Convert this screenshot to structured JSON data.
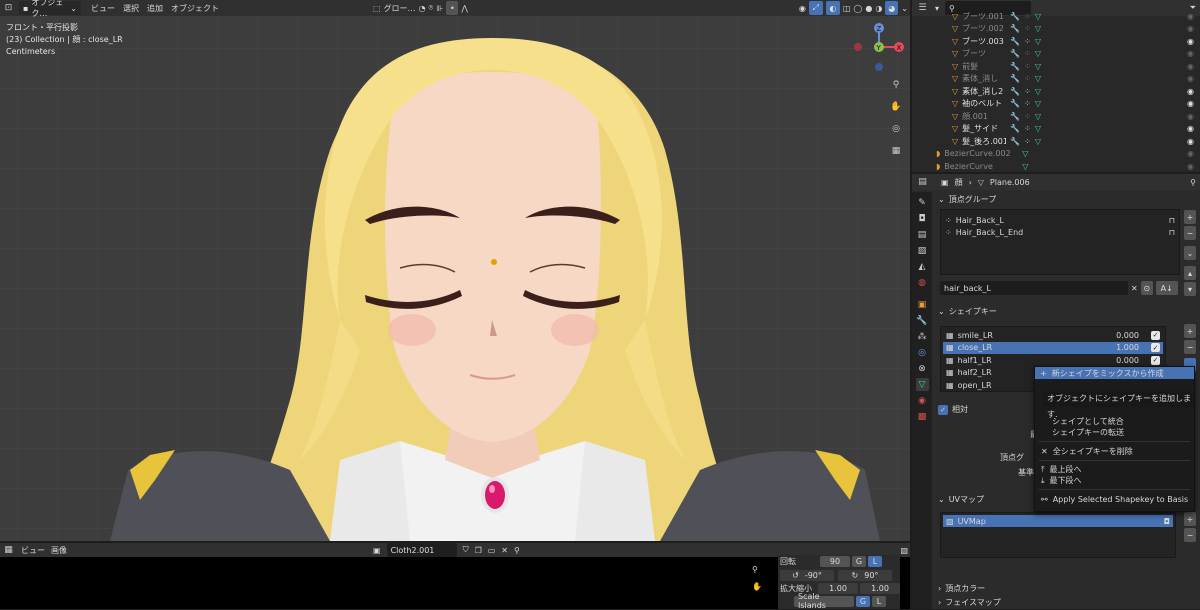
{
  "viewport": {
    "menu": [
      "ビュー",
      "選択",
      "追加",
      "オブジェクト"
    ],
    "mode": "オブジェク…",
    "transform": "グロー…",
    "overlay_line1": "フロント・平行投影",
    "overlay_line2": "(23) Collection | 顔 : close_LR",
    "overlay_line3": "Centimeters"
  },
  "uv_editor": {
    "menu": [
      "ビュー",
      "画像"
    ],
    "image_name": "Cloth2.001",
    "rot_label": "回転",
    "rot_buttons": [
      "90",
      "G",
      "L"
    ],
    "rot_values": [
      "-90°",
      "90°"
    ],
    "scale_label": "拡大縮小",
    "scale_values": [
      "1.00",
      "1.00"
    ],
    "scale_islands": "Scale Islands",
    "scale_islands_btns": [
      "G",
      "L"
    ]
  },
  "outliner": {
    "items": [
      {
        "name": "ブーツ.001",
        "bold": false
      },
      {
        "name": "ブーツ.002",
        "bold": false
      },
      {
        "name": "ブーツ.003",
        "bold": true
      },
      {
        "name": "ブーツ",
        "bold": false
      },
      {
        "name": "前髪",
        "bold": false
      },
      {
        "name": "素体_消し",
        "bold": false
      },
      {
        "name": "素体_消し2",
        "bold": true
      },
      {
        "name": "袖のベルト",
        "bold": true
      },
      {
        "name": "顔.001",
        "bold": false
      },
      {
        "name": "髪_サイド",
        "bold": true
      },
      {
        "name": "髪_後ろ.001",
        "bold": true
      },
      {
        "name": "BezierCurve.002",
        "bold": false
      },
      {
        "name": "BezierCurve",
        "bold": false
      }
    ]
  },
  "properties": {
    "breadcrumb_object": "顔",
    "breadcrumb_mesh": "Plane.006",
    "vertex_groups": {
      "title": "頂点グループ",
      "items": [
        "Hair_Back_L",
        "Hair_Back_L_End"
      ],
      "filter_value": "hair_back_L"
    },
    "shape_keys": {
      "title": "シェイプキー",
      "items": [
        {
          "name": "smile_LR",
          "value": "0.000",
          "selected": false
        },
        {
          "name": "close_LR",
          "value": "1.000",
          "selected": true
        },
        {
          "name": "half1_LR",
          "value": "0.000",
          "selected": false
        },
        {
          "name": "half2_LR",
          "value": "",
          "selected": false
        },
        {
          "name": "open_LR",
          "value": "",
          "selected": false
        }
      ],
      "relative_label": "相対",
      "partial_labels": [
        "最",
        "頂点グ",
        "基準"
      ]
    },
    "context_menu": {
      "header": "新シェイプをミックスから作成",
      "tooltip": "オブジェクトにシェイプキーを追加します.",
      "items": [
        "シェイプとして統合",
        "シェイプキーの転送",
        "全シェイプキーを削除",
        "最上段へ",
        "最下段へ",
        "Apply Selected Shapekey to Basis"
      ]
    },
    "uv_maps": {
      "title": "UVマップ",
      "items": [
        "UVMap"
      ]
    },
    "vertex_colors": {
      "title": "頂点カラー"
    },
    "face_maps": {
      "title": "フェイスマップ"
    }
  },
  "colors": {
    "selection_blue": "#4772b3",
    "mesh_green": "#3ad39b",
    "hair": "#f6e38a",
    "skin": "#f6d8c4"
  }
}
